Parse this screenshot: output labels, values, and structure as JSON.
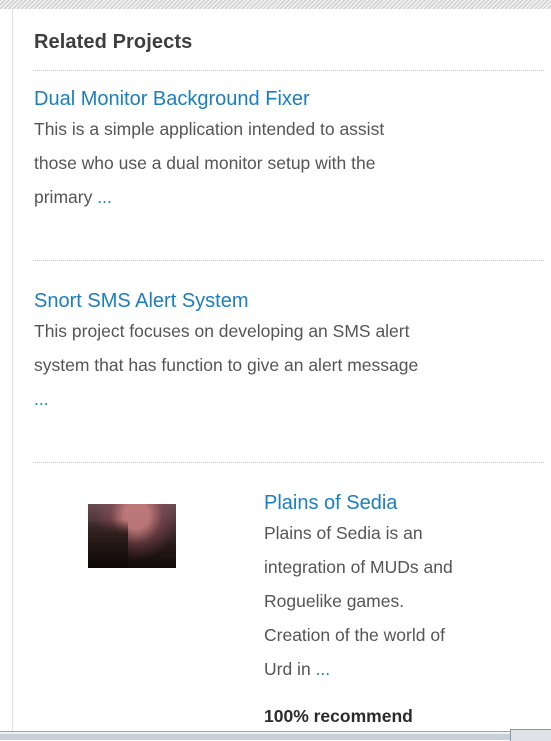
{
  "section": {
    "title": "Related Projects"
  },
  "projects": [
    {
      "title": "Dual Monitor Background Fixer",
      "description_lines": [
        "This is a simple application intended to assist",
        "those who use a dual monitor setup with the",
        "primary"
      ],
      "more": "..."
    },
    {
      "title": "Snort SMS Alert System",
      "description_lines": [
        "This project focuses on developing an SMS alert",
        "system that has function to give an alert message"
      ],
      "more": "..."
    },
    {
      "title": "Plains of Sedia",
      "description_lines": [
        "Plains of Sedia is an",
        "integration of MUDs and",
        "Roguelike games.",
        "Creation of the world of",
        "Urd in"
      ],
      "more": "...",
      "recommend": "100% recommend"
    }
  ],
  "colors": {
    "link": "#1a7ec1",
    "text": "#555555",
    "heading": "#3e3e3e"
  }
}
